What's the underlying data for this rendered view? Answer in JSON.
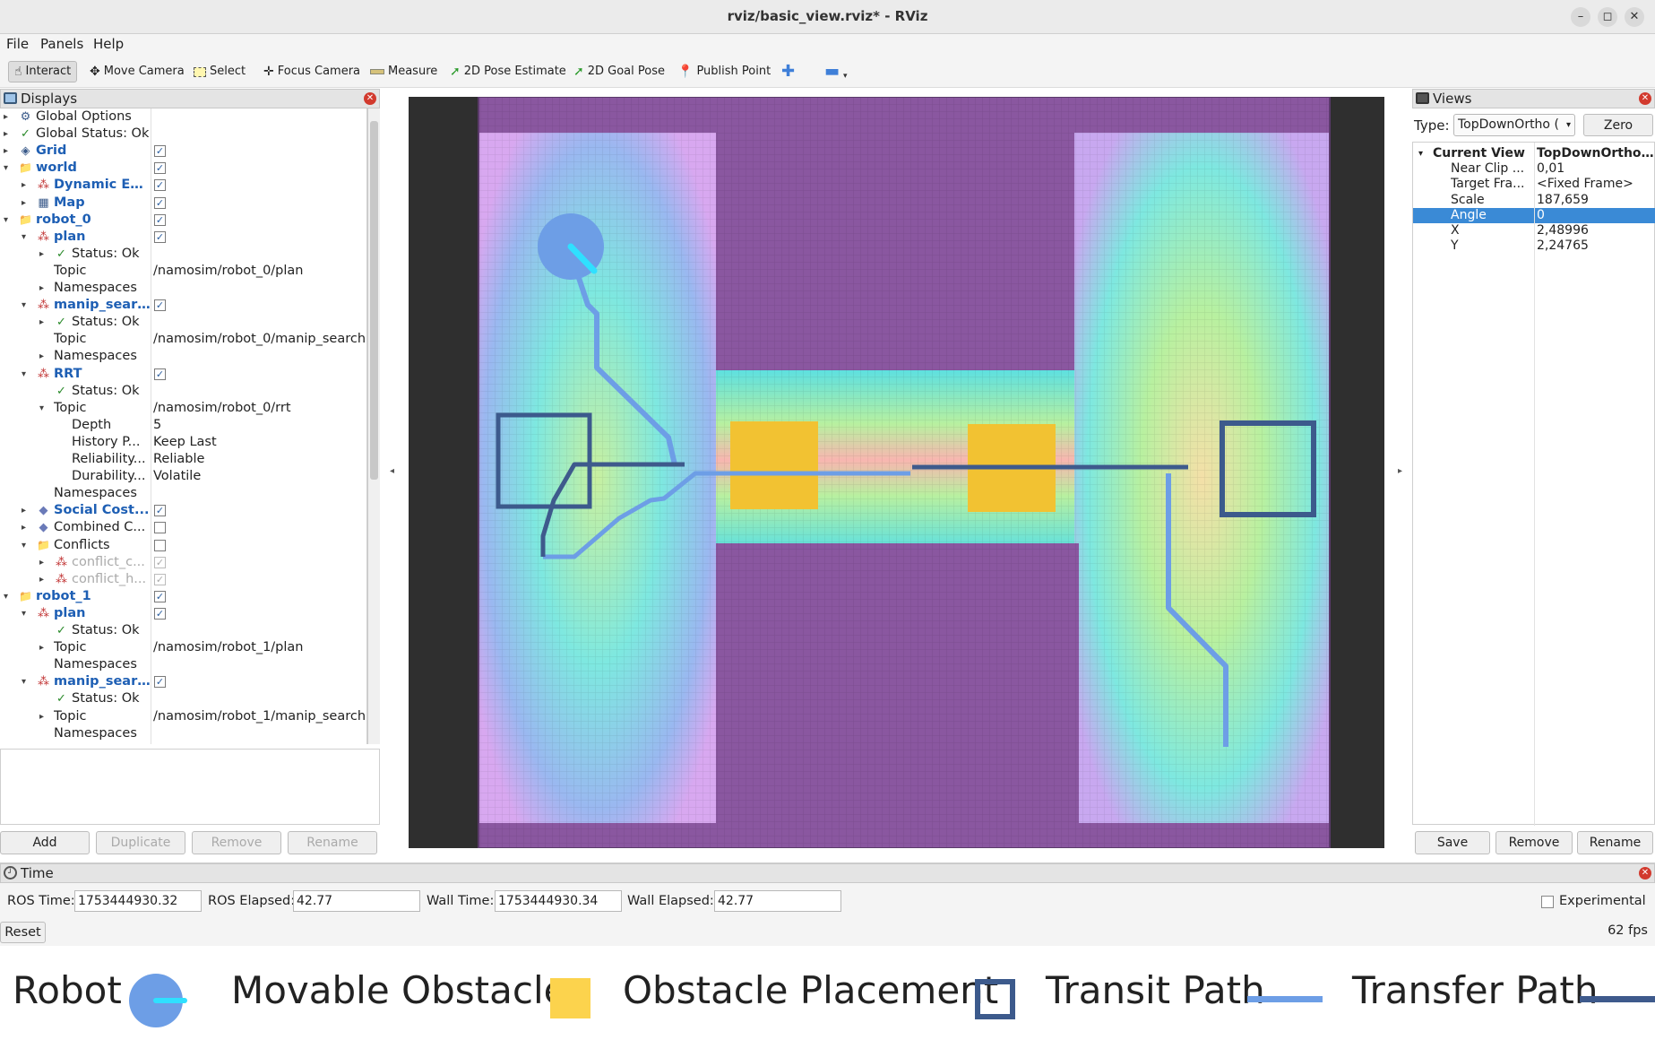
{
  "window": {
    "title": "rviz/basic_view.rviz* - RViz",
    "minimize": "–",
    "maximize": "◻",
    "close": "✕"
  },
  "menu": [
    "File",
    "Panels",
    "Help"
  ],
  "toolbar": {
    "tools": [
      {
        "label": "Interact",
        "icon": "interact-icon",
        "active": true
      },
      {
        "label": "Move Camera",
        "icon": "move-camera-icon",
        "active": false
      },
      {
        "label": "Select",
        "icon": "select-icon",
        "active": false
      },
      {
        "label": "Focus Camera",
        "icon": "focus-camera-icon",
        "active": false
      },
      {
        "label": "Measure",
        "icon": "measure-icon",
        "active": false
      },
      {
        "label": "2D Pose Estimate",
        "icon": "pose-estimate-icon",
        "active": false
      },
      {
        "label": "2D Goal Pose",
        "icon": "goal-pose-icon",
        "active": false
      },
      {
        "label": "Publish Point",
        "icon": "publish-point-icon",
        "active": false
      }
    ]
  },
  "displays": {
    "title": "Displays",
    "rows": [
      {
        "label": "Global Options",
        "level": 0,
        "expander": "▸",
        "icon": "⚙",
        "style": "",
        "value": "",
        "checkbox": ""
      },
      {
        "label": "Global Status: Ok",
        "level": 0,
        "expander": "▸",
        "icon": "✓",
        "style": "check",
        "value": "",
        "checkbox": ""
      },
      {
        "label": "Grid",
        "level": 0,
        "expander": "▸",
        "icon": "◈",
        "style": "blue",
        "value": "",
        "checkbox": "on"
      },
      {
        "label": "world",
        "level": 0,
        "expander": "▾",
        "icon": "📁",
        "style": "blue",
        "value": "",
        "checkbox": "on"
      },
      {
        "label": "Dynamic En...",
        "level": 1,
        "expander": "▸",
        "icon": "⁂",
        "style": "blue",
        "value": "",
        "checkbox": "on"
      },
      {
        "label": "Map",
        "level": 1,
        "expander": "▸",
        "icon": "▦",
        "style": "blue",
        "value": "",
        "checkbox": "on"
      },
      {
        "label": "robot_0",
        "level": 0,
        "expander": "▾",
        "icon": "📁",
        "style": "blue",
        "value": "",
        "checkbox": "on"
      },
      {
        "label": "plan",
        "level": 1,
        "expander": "▾",
        "icon": "⁂",
        "style": "blue",
        "value": "",
        "checkbox": "on"
      },
      {
        "label": "Status: Ok",
        "level": 2,
        "expander": "▸",
        "icon": "✓",
        "style": "",
        "value": "",
        "checkbox": ""
      },
      {
        "label": "Topic",
        "level": 2,
        "expander": "",
        "icon": "",
        "style": "",
        "value": "/namosim/robot_0/plan",
        "checkbox": ""
      },
      {
        "label": "Namespaces",
        "level": 2,
        "expander": "▸",
        "icon": "",
        "style": "",
        "value": "",
        "checkbox": ""
      },
      {
        "label": "manip_search",
        "level": 1,
        "expander": "▾",
        "icon": "⁂",
        "style": "blue",
        "value": "",
        "checkbox": "on"
      },
      {
        "label": "Status: Ok",
        "level": 2,
        "expander": "▸",
        "icon": "✓",
        "style": "",
        "value": "",
        "checkbox": ""
      },
      {
        "label": "Topic",
        "level": 2,
        "expander": "",
        "icon": "",
        "style": "",
        "value": "/namosim/robot_0/manip_search",
        "checkbox": ""
      },
      {
        "label": "Namespaces",
        "level": 2,
        "expander": "▸",
        "icon": "",
        "style": "",
        "value": "",
        "checkbox": ""
      },
      {
        "label": "RRT",
        "level": 1,
        "expander": "▾",
        "icon": "⁂",
        "style": "blue",
        "value": "",
        "checkbox": "on"
      },
      {
        "label": "Status: Ok",
        "level": 2,
        "expander": "",
        "icon": "✓",
        "style": "",
        "value": "",
        "checkbox": ""
      },
      {
        "label": "Topic",
        "level": 2,
        "expander": "▾",
        "icon": "",
        "style": "",
        "value": "/namosim/robot_0/rrt",
        "checkbox": ""
      },
      {
        "label": "Depth",
        "level": 3,
        "expander": "",
        "icon": "",
        "style": "",
        "value": "5",
        "checkbox": ""
      },
      {
        "label": "History P...",
        "level": 3,
        "expander": "",
        "icon": "",
        "style": "",
        "value": "Keep Last",
        "checkbox": ""
      },
      {
        "label": "Reliability...",
        "level": 3,
        "expander": "",
        "icon": "",
        "style": "",
        "value": "Reliable",
        "checkbox": ""
      },
      {
        "label": "Durability...",
        "level": 3,
        "expander": "",
        "icon": "",
        "style": "",
        "value": "Volatile",
        "checkbox": ""
      },
      {
        "label": "Namespaces",
        "level": 2,
        "expander": "",
        "icon": "",
        "style": "",
        "value": "",
        "checkbox": ""
      },
      {
        "label": "Social Cost...",
        "level": 1,
        "expander": "▸",
        "icon": "◆",
        "style": "blue",
        "value": "",
        "checkbox": "on"
      },
      {
        "label": "Combined C...",
        "level": 1,
        "expander": "▸",
        "icon": "◆",
        "style": "",
        "value": "",
        "checkbox": "off"
      },
      {
        "label": "Conflicts",
        "level": 1,
        "expander": "▾",
        "icon": "📁",
        "style": "",
        "value": "",
        "checkbox": "off"
      },
      {
        "label": "conflict_c...",
        "level": 2,
        "expander": "▸",
        "icon": "⁂",
        "style": "grey",
        "value": "",
        "checkbox": "dis"
      },
      {
        "label": "conflict_h...",
        "level": 2,
        "expander": "▸",
        "icon": "⁂",
        "style": "grey",
        "value": "",
        "checkbox": "dis"
      },
      {
        "label": "robot_1",
        "level": 0,
        "expander": "▾",
        "icon": "📁",
        "style": "blue",
        "value": "",
        "checkbox": "on"
      },
      {
        "label": "plan",
        "level": 1,
        "expander": "▾",
        "icon": "⁂",
        "style": "blue",
        "value": "",
        "checkbox": "on"
      },
      {
        "label": "Status: Ok",
        "level": 2,
        "expander": "",
        "icon": "✓",
        "style": "",
        "value": "",
        "checkbox": ""
      },
      {
        "label": "Topic",
        "level": 2,
        "expander": "▸",
        "icon": "",
        "style": "",
        "value": "/namosim/robot_1/plan",
        "checkbox": ""
      },
      {
        "label": "Namespaces",
        "level": 2,
        "expander": "",
        "icon": "",
        "style": "",
        "value": "",
        "checkbox": ""
      },
      {
        "label": "manip_search",
        "level": 1,
        "expander": "▾",
        "icon": "⁂",
        "style": "blue",
        "value": "",
        "checkbox": "on"
      },
      {
        "label": "Status: Ok",
        "level": 2,
        "expander": "",
        "icon": "✓",
        "style": "",
        "value": "",
        "checkbox": ""
      },
      {
        "label": "Topic",
        "level": 2,
        "expander": "▸",
        "icon": "",
        "style": "",
        "value": "/namosim/robot_1/manip_search",
        "checkbox": ""
      },
      {
        "label": "Namespaces",
        "level": 2,
        "expander": "",
        "icon": "",
        "style": "",
        "value": "",
        "checkbox": ""
      }
    ],
    "buttons": {
      "add": "Add",
      "duplicate": "Duplicate",
      "remove": "Remove",
      "rename": "Rename"
    }
  },
  "views": {
    "title": "Views",
    "type_label": "Type:",
    "type_value": "TopDownOrtho (",
    "zero_label": "Zero",
    "properties": [
      {
        "key": "Current View",
        "value": "TopDownOrtho ...",
        "header": true,
        "selected": false
      },
      {
        "key": "Near Clip ...",
        "value": "0,01",
        "header": false,
        "selected": false
      },
      {
        "key": "Target Fra...",
        "value": "<Fixed Frame>",
        "header": false,
        "selected": false
      },
      {
        "key": "Scale",
        "value": "187,659",
        "header": false,
        "selected": false
      },
      {
        "key": "Angle",
        "value": "0",
        "header": false,
        "selected": true
      },
      {
        "key": "X",
        "value": "2,48996",
        "header": false,
        "selected": false
      },
      {
        "key": "Y",
        "value": "2,24765",
        "header": false,
        "selected": false
      }
    ],
    "buttons": {
      "save": "Save",
      "remove": "Remove",
      "rename": "Rename"
    }
  },
  "time": {
    "title": "Time",
    "ros_time_label": "ROS Time:",
    "ros_time": "1753444930.32",
    "ros_elapsed_label": "ROS Elapsed:",
    "ros_elapsed": "42.77",
    "wall_time_label": "Wall Time:",
    "wall_time": "1753444930.34",
    "wall_elapsed_label": "Wall Elapsed:",
    "wall_elapsed": "42.77",
    "experimental_label": "Experimental",
    "reset_label": "Reset",
    "fps": "62 fps"
  },
  "legend": {
    "robot": "Robot",
    "movable_obstacle": "Movable Obstacle",
    "obstacle_placement": "Obstacle Placement",
    "transit_path": "Transit Path",
    "transfer_path": "Transfer Path"
  },
  "colors": {
    "obstacle": "#8a57a0",
    "movable": "#f2c232",
    "placement": "#3c5a8c",
    "transit": "#6d9ee6",
    "transfer": "#3e5a8c",
    "robot": "#6d9ee6",
    "robot_heading": "#2fe0ff"
  }
}
